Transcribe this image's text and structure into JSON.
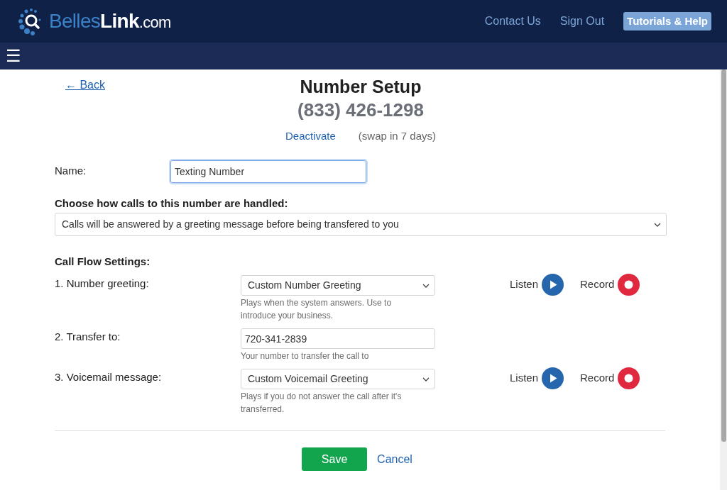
{
  "header": {
    "logo": {
      "part_1": "Belles",
      "part_2": "Link",
      "part_3": ".com"
    },
    "links": [
      {
        "label": "Contact Us",
        "kind": "link"
      },
      {
        "label": "Sign Out",
        "kind": "link"
      },
      {
        "label": "Tutorials & Help",
        "kind": "button"
      }
    ]
  },
  "nav": {
    "menu_icon": "☰"
  },
  "page": {
    "back": "← Back",
    "title": "Number Setup",
    "number": "(833) 426-1298",
    "deactivate": "Deactivate",
    "swap_note": "(swap in 7 days)"
  },
  "name_field": {
    "label": "Name:",
    "value": "Texting Number",
    "focused": true
  },
  "handling": {
    "label": "Choose how calls to this number are handled:",
    "value": "Calls will be answered by a greeting message before being transfered to you"
  },
  "call_flow": {
    "title": "Call Flow Settings:",
    "rows": [
      {
        "label": "1. Number greeting:",
        "kind": "select",
        "value": "Custom Number Greeting",
        "hint": "Plays when the system answers. Use to introduce your business.",
        "actions": [
          {
            "label": "Listen",
            "kind": "play"
          },
          {
            "label": "Record",
            "kind": "record"
          }
        ]
      },
      {
        "label": "2. Transfer to:",
        "kind": "input",
        "value": "720-341-2839",
        "hint": "Your number to transfer the call to"
      },
      {
        "label": "3. Voicemail message:",
        "kind": "select",
        "value": "Custom Voicemail Greeting",
        "hint": "Plays if you do not answer the call after it's transferred.",
        "actions": [
          {
            "label": "Listen",
            "kind": "play"
          },
          {
            "label": "Record",
            "kind": "record"
          }
        ]
      }
    ]
  },
  "footer": {
    "save": "Save",
    "cancel": "Cancel"
  }
}
